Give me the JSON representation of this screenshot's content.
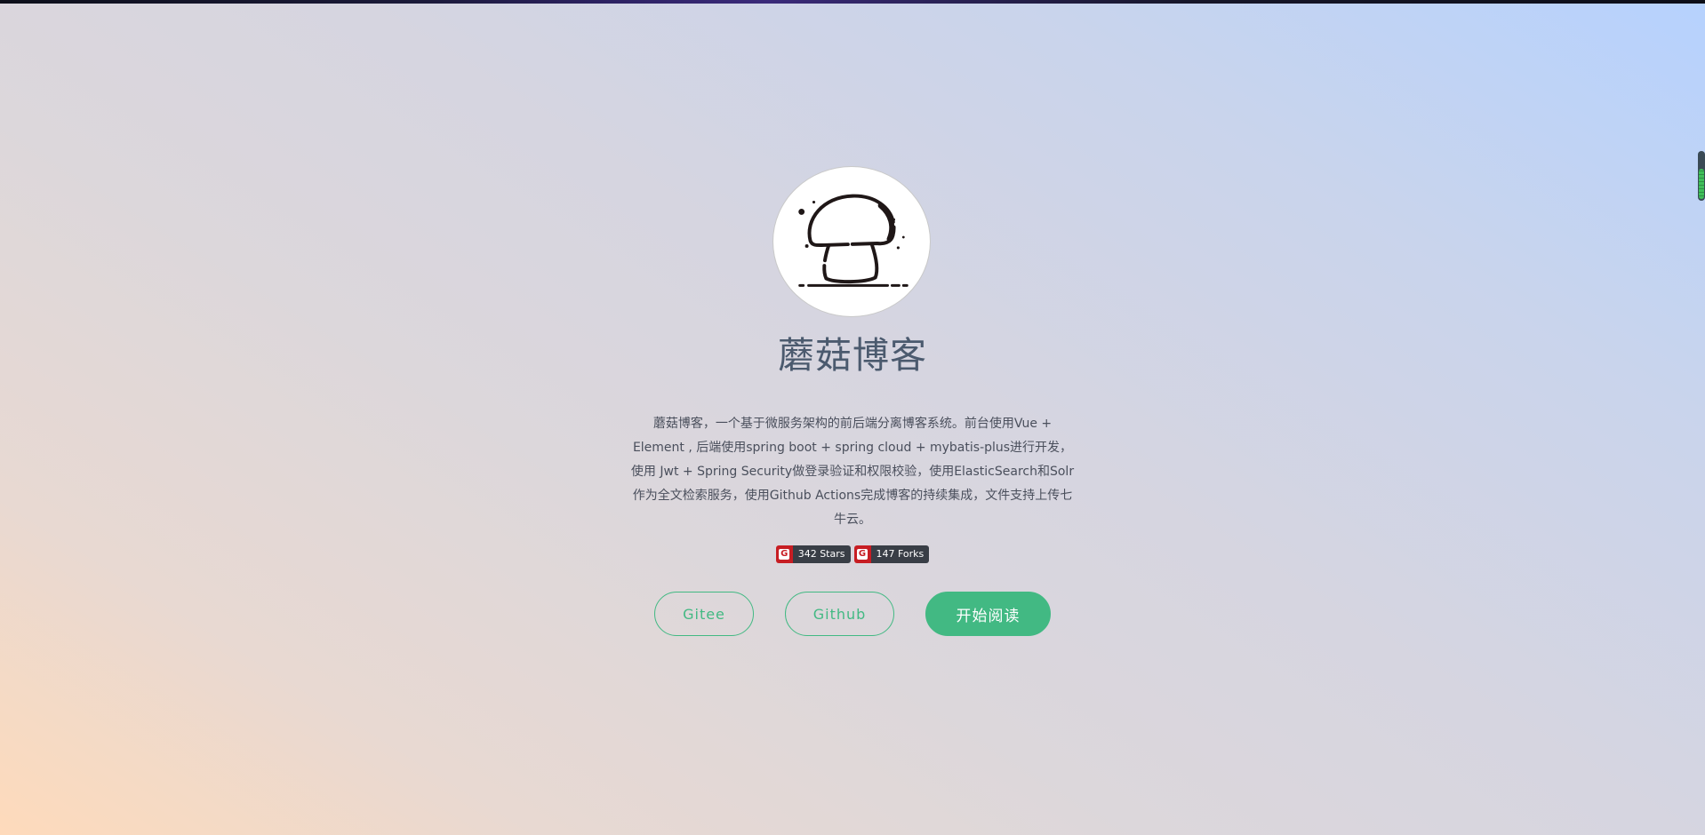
{
  "site": {
    "title": "蘑菇博客",
    "description": "蘑菇博客，一个基于微服务架构的前后端分离博客系统。前台使用Vue + Element , 后端使用spring boot + spring cloud + mybatis-plus进行开发，使用 Jwt + Spring Security做登录验证和权限校验，使用ElasticSearch和Solr作为全文检索服务，使用Github Actions完成博客的持续集成，文件支持上传七牛云。"
  },
  "logo": {
    "icon": "mushroom-icon"
  },
  "badges": [
    {
      "icon": "gitee-logo-icon",
      "label": "342 Stars"
    },
    {
      "icon": "gitee-logo-icon",
      "label": "147 Forks"
    }
  ],
  "buttons": {
    "gitee": "Gitee",
    "github": "Github",
    "start_reading": "开始阅读"
  },
  "colors": {
    "accent": "#42b983",
    "badge_brand": "#c71d23",
    "badge_dark": "#393e46",
    "title_text": "#4b5a6e"
  }
}
